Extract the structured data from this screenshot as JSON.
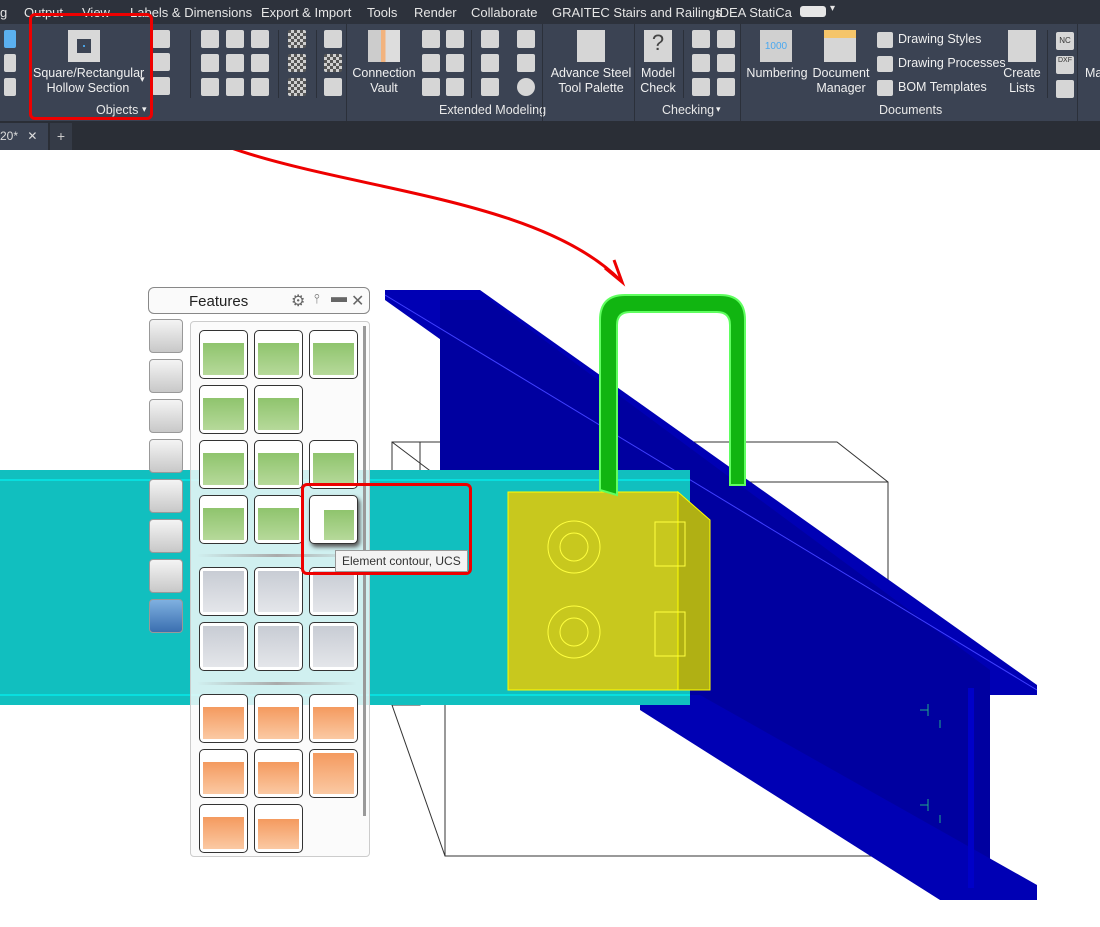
{
  "menu_tabs": [
    "g",
    "Output",
    "View",
    "Labels & Dimensions",
    "Export & Import",
    "Tools",
    "Render",
    "Collaborate",
    "GRAITEC Stairs and Railings",
    "IDEA StatiCa"
  ],
  "ribbon": {
    "objects": {
      "main_button": "Square/Rectangular\nHollow Section",
      "main_line1": "Square/Rectangular",
      "main_line2": "Hollow Section",
      "group_label": "Objects"
    },
    "extended_modeling": {
      "connection_vault_1": "Connection",
      "connection_vault_2": "Vault",
      "group_label": "Extended Modeling"
    },
    "tool_palette": {
      "line1": "Advance Steel",
      "line2": "Tool Palette"
    },
    "checking": {
      "model_check_1": "Model",
      "model_check_2": "Check",
      "group_label": "Checking"
    },
    "documents": {
      "numbering": "Numbering",
      "numbering_icon_text": "1000",
      "doc_manager_1": "Document",
      "doc_manager_2": "Manager",
      "drawing_styles": "Drawing Styles",
      "drawing_processes": "Drawing Processes",
      "bom_templates": "BOM Templates",
      "create_lists_1": "Create",
      "create_lists_2": "Lists",
      "group_label": "Documents",
      "nc_label": "NC",
      "dxf_label": "DXF"
    },
    "truncated_next": "Ma"
  },
  "doc_tab": {
    "label": "20*",
    "close": "✕",
    "add": "+"
  },
  "features_palette": {
    "title": "Features",
    "tooltip": "Element contour, UCS"
  },
  "colors": {
    "accent_red": "#e00000",
    "beam_blue": "#0000a0",
    "beam_cyan": "#11bfbf",
    "plate_yellow": "#c8c81e",
    "hss_green": "#11b511"
  }
}
